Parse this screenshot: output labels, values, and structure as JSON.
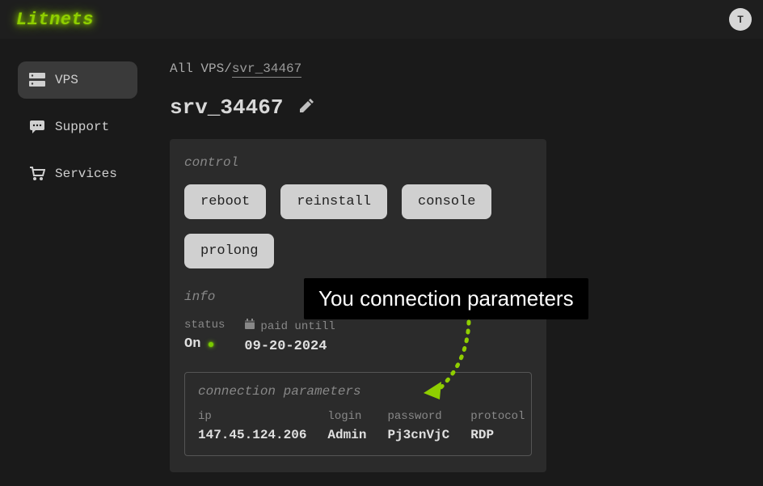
{
  "brand": "Litnets",
  "avatar_initial": "T",
  "sidebar": {
    "items": [
      {
        "label": "VPS"
      },
      {
        "label": "Support"
      },
      {
        "label": "Services"
      }
    ]
  },
  "breadcrumb": {
    "root": "All VPS",
    "sep": "/",
    "current": "svr_34467"
  },
  "page_title": "srv_34467",
  "panel": {
    "control_label": "control",
    "buttons": {
      "reboot": "reboot",
      "reinstall": "reinstall",
      "console": "console",
      "prolong": "prolong"
    },
    "info_label": "info",
    "status_label": "status",
    "status_value": "On",
    "paid_label": "paid untill",
    "paid_value": "09-20-2024",
    "conn_label": "connection parameters",
    "conn": {
      "ip_label": "ip",
      "ip": "147.45.124.206",
      "login_label": "login",
      "login": "Admin",
      "password_label": "password",
      "password": "Pj3cnVjC",
      "protocol_label": "protocol",
      "protocol": "RDP"
    }
  },
  "callout_text": "You connection parameters"
}
